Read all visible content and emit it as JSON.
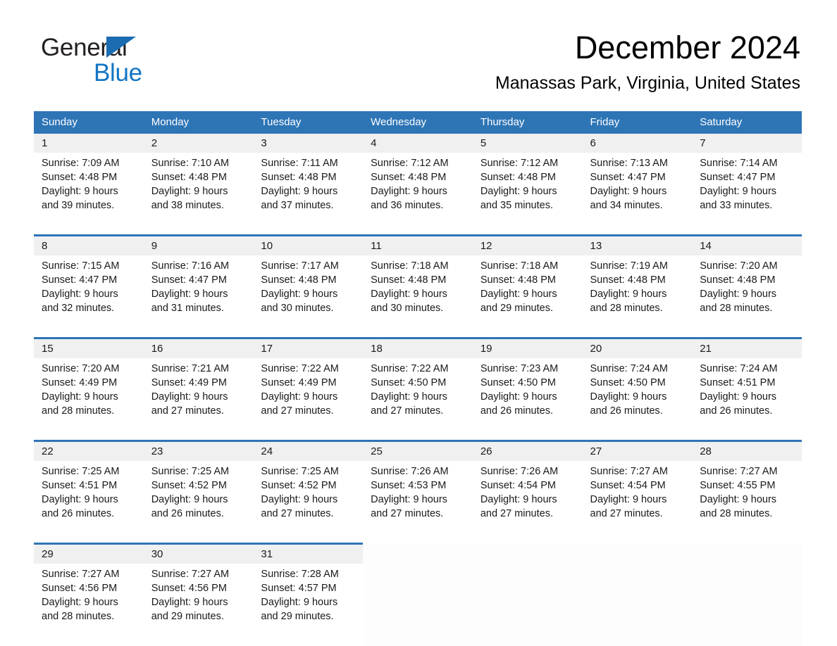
{
  "brand": {
    "name_line1": "General",
    "name_line2": "Blue",
    "triangle_color": "#1b6cb0",
    "blue_text_color": "#1275c4"
  },
  "header": {
    "title": "December 2024",
    "subtitle": "Manassas Park, Virginia, United States"
  },
  "theme": {
    "header_blue": "#2e75b6",
    "daynum_background": "#f0f0f0",
    "page_background": "#ffffff"
  },
  "labels": {
    "sunrise_prefix": "Sunrise:",
    "sunset_prefix": "Sunset:",
    "daylight_prefix": "Daylight:"
  },
  "weekday_headers": [
    "Sunday",
    "Monday",
    "Tuesday",
    "Wednesday",
    "Thursday",
    "Friday",
    "Saturday"
  ],
  "weeks": [
    [
      {
        "day": "1",
        "sunrise": "Sunrise: 7:09 AM",
        "sunset": "Sunset: 4:48 PM",
        "daylight_line1": "Daylight: 9 hours",
        "daylight_line2": "and 39 minutes."
      },
      {
        "day": "2",
        "sunrise": "Sunrise: 7:10 AM",
        "sunset": "Sunset: 4:48 PM",
        "daylight_line1": "Daylight: 9 hours",
        "daylight_line2": "and 38 minutes."
      },
      {
        "day": "3",
        "sunrise": "Sunrise: 7:11 AM",
        "sunset": "Sunset: 4:48 PM",
        "daylight_line1": "Daylight: 9 hours",
        "daylight_line2": "and 37 minutes."
      },
      {
        "day": "4",
        "sunrise": "Sunrise: 7:12 AM",
        "sunset": "Sunset: 4:48 PM",
        "daylight_line1": "Daylight: 9 hours",
        "daylight_line2": "and 36 minutes."
      },
      {
        "day": "5",
        "sunrise": "Sunrise: 7:12 AM",
        "sunset": "Sunset: 4:48 PM",
        "daylight_line1": "Daylight: 9 hours",
        "daylight_line2": "and 35 minutes."
      },
      {
        "day": "6",
        "sunrise": "Sunrise: 7:13 AM",
        "sunset": "Sunset: 4:47 PM",
        "daylight_line1": "Daylight: 9 hours",
        "daylight_line2": "and 34 minutes."
      },
      {
        "day": "7",
        "sunrise": "Sunrise: 7:14 AM",
        "sunset": "Sunset: 4:47 PM",
        "daylight_line1": "Daylight: 9 hours",
        "daylight_line2": "and 33 minutes."
      }
    ],
    [
      {
        "day": "8",
        "sunrise": "Sunrise: 7:15 AM",
        "sunset": "Sunset: 4:47 PM",
        "daylight_line1": "Daylight: 9 hours",
        "daylight_line2": "and 32 minutes."
      },
      {
        "day": "9",
        "sunrise": "Sunrise: 7:16 AM",
        "sunset": "Sunset: 4:47 PM",
        "daylight_line1": "Daylight: 9 hours",
        "daylight_line2": "and 31 minutes."
      },
      {
        "day": "10",
        "sunrise": "Sunrise: 7:17 AM",
        "sunset": "Sunset: 4:48 PM",
        "daylight_line1": "Daylight: 9 hours",
        "daylight_line2": "and 30 minutes."
      },
      {
        "day": "11",
        "sunrise": "Sunrise: 7:18 AM",
        "sunset": "Sunset: 4:48 PM",
        "daylight_line1": "Daylight: 9 hours",
        "daylight_line2": "and 30 minutes."
      },
      {
        "day": "12",
        "sunrise": "Sunrise: 7:18 AM",
        "sunset": "Sunset: 4:48 PM",
        "daylight_line1": "Daylight: 9 hours",
        "daylight_line2": "and 29 minutes."
      },
      {
        "day": "13",
        "sunrise": "Sunrise: 7:19 AM",
        "sunset": "Sunset: 4:48 PM",
        "daylight_line1": "Daylight: 9 hours",
        "daylight_line2": "and 28 minutes."
      },
      {
        "day": "14",
        "sunrise": "Sunrise: 7:20 AM",
        "sunset": "Sunset: 4:48 PM",
        "daylight_line1": "Daylight: 9 hours",
        "daylight_line2": "and 28 minutes."
      }
    ],
    [
      {
        "day": "15",
        "sunrise": "Sunrise: 7:20 AM",
        "sunset": "Sunset: 4:49 PM",
        "daylight_line1": "Daylight: 9 hours",
        "daylight_line2": "and 28 minutes."
      },
      {
        "day": "16",
        "sunrise": "Sunrise: 7:21 AM",
        "sunset": "Sunset: 4:49 PM",
        "daylight_line1": "Daylight: 9 hours",
        "daylight_line2": "and 27 minutes."
      },
      {
        "day": "17",
        "sunrise": "Sunrise: 7:22 AM",
        "sunset": "Sunset: 4:49 PM",
        "daylight_line1": "Daylight: 9 hours",
        "daylight_line2": "and 27 minutes."
      },
      {
        "day": "18",
        "sunrise": "Sunrise: 7:22 AM",
        "sunset": "Sunset: 4:50 PM",
        "daylight_line1": "Daylight: 9 hours",
        "daylight_line2": "and 27 minutes."
      },
      {
        "day": "19",
        "sunrise": "Sunrise: 7:23 AM",
        "sunset": "Sunset: 4:50 PM",
        "daylight_line1": "Daylight: 9 hours",
        "daylight_line2": "and 26 minutes."
      },
      {
        "day": "20",
        "sunrise": "Sunrise: 7:24 AM",
        "sunset": "Sunset: 4:50 PM",
        "daylight_line1": "Daylight: 9 hours",
        "daylight_line2": "and 26 minutes."
      },
      {
        "day": "21",
        "sunrise": "Sunrise: 7:24 AM",
        "sunset": "Sunset: 4:51 PM",
        "daylight_line1": "Daylight: 9 hours",
        "daylight_line2": "and 26 minutes."
      }
    ],
    [
      {
        "day": "22",
        "sunrise": "Sunrise: 7:25 AM",
        "sunset": "Sunset: 4:51 PM",
        "daylight_line1": "Daylight: 9 hours",
        "daylight_line2": "and 26 minutes."
      },
      {
        "day": "23",
        "sunrise": "Sunrise: 7:25 AM",
        "sunset": "Sunset: 4:52 PM",
        "daylight_line1": "Daylight: 9 hours",
        "daylight_line2": "and 26 minutes."
      },
      {
        "day": "24",
        "sunrise": "Sunrise: 7:25 AM",
        "sunset": "Sunset: 4:52 PM",
        "daylight_line1": "Daylight: 9 hours",
        "daylight_line2": "and 27 minutes."
      },
      {
        "day": "25",
        "sunrise": "Sunrise: 7:26 AM",
        "sunset": "Sunset: 4:53 PM",
        "daylight_line1": "Daylight: 9 hours",
        "daylight_line2": "and 27 minutes."
      },
      {
        "day": "26",
        "sunrise": "Sunrise: 7:26 AM",
        "sunset": "Sunset: 4:54 PM",
        "daylight_line1": "Daylight: 9 hours",
        "daylight_line2": "and 27 minutes."
      },
      {
        "day": "27",
        "sunrise": "Sunrise: 7:27 AM",
        "sunset": "Sunset: 4:54 PM",
        "daylight_line1": "Daylight: 9 hours",
        "daylight_line2": "and 27 minutes."
      },
      {
        "day": "28",
        "sunrise": "Sunrise: 7:27 AM",
        "sunset": "Sunset: 4:55 PM",
        "daylight_line1": "Daylight: 9 hours",
        "daylight_line2": "and 28 minutes."
      }
    ],
    [
      {
        "day": "29",
        "sunrise": "Sunrise: 7:27 AM",
        "sunset": "Sunset: 4:56 PM",
        "daylight_line1": "Daylight: 9 hours",
        "daylight_line2": "and 28 minutes."
      },
      {
        "day": "30",
        "sunrise": "Sunrise: 7:27 AM",
        "sunset": "Sunset: 4:56 PM",
        "daylight_line1": "Daylight: 9 hours",
        "daylight_line2": "and 29 minutes."
      },
      {
        "day": "31",
        "sunrise": "Sunrise: 7:28 AM",
        "sunset": "Sunset: 4:57 PM",
        "daylight_line1": "Daylight: 9 hours",
        "daylight_line2": "and 29 minutes."
      },
      {
        "day": "",
        "sunrise": "",
        "sunset": "",
        "daylight_line1": "",
        "daylight_line2": ""
      },
      {
        "day": "",
        "sunrise": "",
        "sunset": "",
        "daylight_line1": "",
        "daylight_line2": ""
      },
      {
        "day": "",
        "sunrise": "",
        "sunset": "",
        "daylight_line1": "",
        "daylight_line2": ""
      },
      {
        "day": "",
        "sunrise": "",
        "sunset": "",
        "daylight_line1": "",
        "daylight_line2": ""
      }
    ]
  ]
}
